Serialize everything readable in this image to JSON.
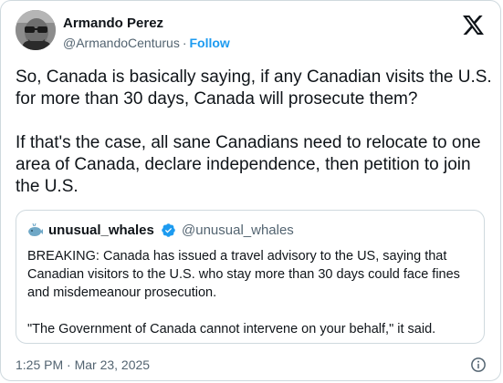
{
  "author": {
    "name": "Armando Perez",
    "handle": "@ArmandoCenturus",
    "separator": "·",
    "follow_label": "Follow"
  },
  "tweet": {
    "paragraphs": [
      "So, Canada is basically saying, if any Canadian visits the U.S. for more than 30 days, Canada will prosecute them?",
      "If that's the case, all sane Canadians need to relocate to one area of Canada, declare independence, then petition to join the U.S."
    ]
  },
  "quote": {
    "name": "unusual_whales",
    "handle": "@unusual_whales",
    "paragraphs": [
      "BREAKING: Canada has issued a travel advisory to the US, saying that Canadian visitors to the U.S. who stay more than 30 days could face fines and misdemeanour prosecution.",
      "\"The Government of Canada cannot intervene on your behalf,\" it said."
    ]
  },
  "footer": {
    "timestamp": "1:25 PM · Mar 23, 2025"
  },
  "icons": {
    "brand": "x-logo-icon",
    "verified": "verified-badge-icon",
    "quote_avatar": "whale-icon",
    "info": "info-icon"
  },
  "colors": {
    "text": "#0f1419",
    "secondary": "#536471",
    "accent": "#1d9bf0",
    "border": "#cfd9de"
  }
}
